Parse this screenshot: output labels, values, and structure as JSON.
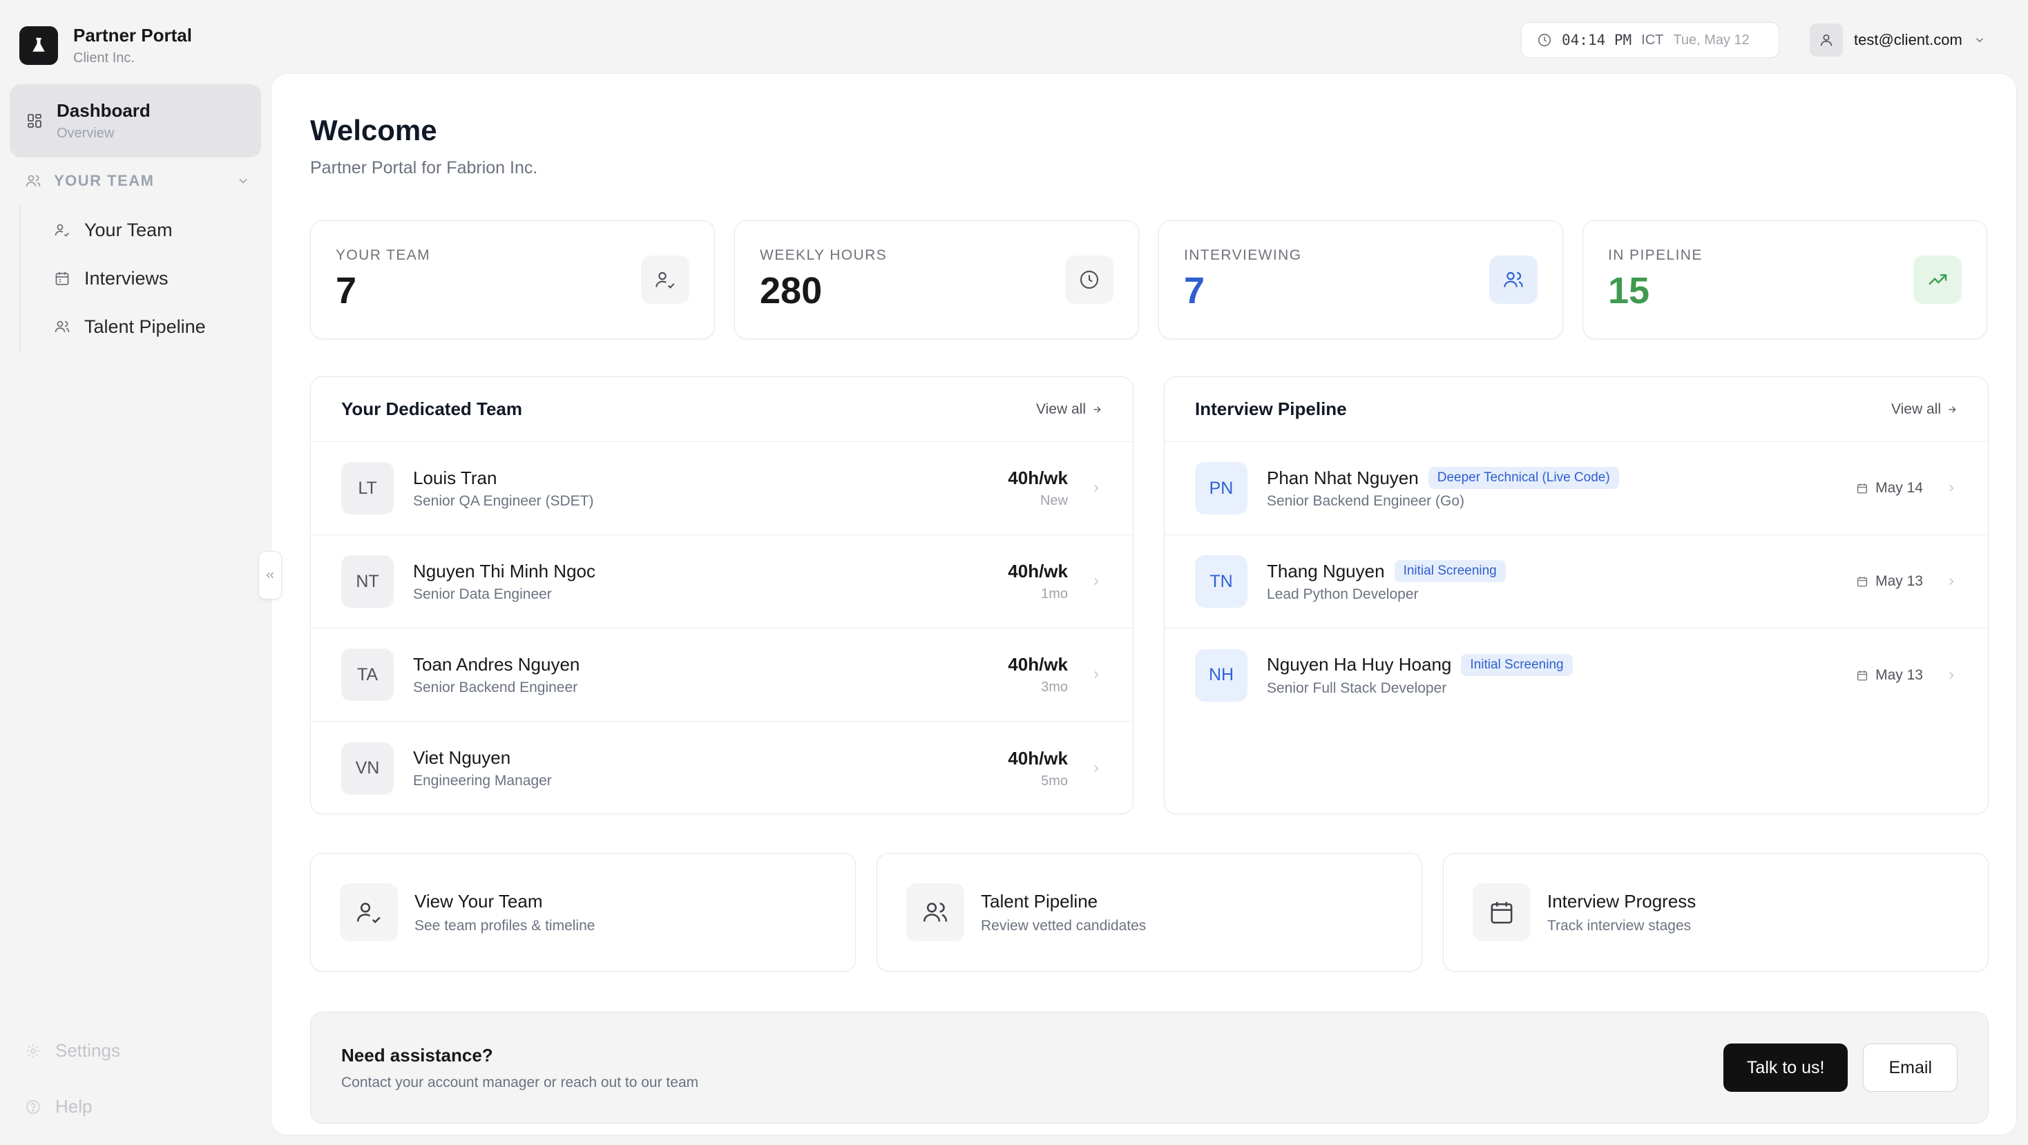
{
  "brand": {
    "title": "Partner Portal",
    "subtitle": "Client Inc."
  },
  "sidebar": {
    "dashboard": {
      "label": "Dashboard",
      "sub": "Overview"
    },
    "section": {
      "label": "YOUR TEAM"
    },
    "items": [
      {
        "label": "Your Team",
        "icon": "user-check-icon"
      },
      {
        "label": "Interviews",
        "icon": "calendar-icon"
      },
      {
        "label": "Talent Pipeline",
        "icon": "users-icon"
      }
    ],
    "settings": "Settings",
    "help": "Help"
  },
  "topbar": {
    "time": "04:14 PM",
    "timezone": "ICT",
    "date": "Tue, May 12",
    "email": "test@client.com"
  },
  "main": {
    "title": "Welcome",
    "subtitle": "Partner Portal for Fabrion Inc."
  },
  "stats": [
    {
      "label": "YOUR TEAM",
      "value": "7",
      "color": "#18181b",
      "icon": "user-check-icon"
    },
    {
      "label": "WEEKLY HOURS",
      "value": "280",
      "color": "#18181b",
      "icon": "clock-icon"
    },
    {
      "label": "INTERVIEWING",
      "value": "7",
      "color": "#2f5fce",
      "icon": "users-icon"
    },
    {
      "label": "IN PIPELINE",
      "value": "15",
      "color": "#3d9a4e",
      "icon": "trending-up-icon"
    }
  ],
  "team": {
    "title": "Your Dedicated Team",
    "view_all": "View all",
    "members": [
      {
        "initials": "LT",
        "name": "Louis Tran",
        "role": "Senior QA Engineer (SDET)",
        "hours": "40h/wk",
        "tenure": "New"
      },
      {
        "initials": "NT",
        "name": "Nguyen Thi Minh Ngoc",
        "role": "Senior Data Engineer",
        "hours": "40h/wk",
        "tenure": "1mo"
      },
      {
        "initials": "TA",
        "name": "Toan Andres Nguyen",
        "role": "Senior Backend Engineer",
        "hours": "40h/wk",
        "tenure": "3mo"
      },
      {
        "initials": "VN",
        "name": "Viet Nguyen",
        "role": "Engineering Manager",
        "hours": "40h/wk",
        "tenure": "5mo"
      }
    ]
  },
  "pipeline": {
    "title": "Interview Pipeline",
    "view_all": "View all",
    "candidates": [
      {
        "initials": "PN",
        "name": "Phan Nhat Nguyen",
        "stage": "Deeper Technical (Live Code)",
        "role": "Senior Backend Engineer (Go)",
        "date": "May 14"
      },
      {
        "initials": "TN",
        "name": "Thang Nguyen",
        "stage": "Initial Screening",
        "role": "Lead Python Developer",
        "date": "May 13"
      },
      {
        "initials": "NH",
        "name": "Nguyen Ha Huy Hoang",
        "stage": "Initial Screening",
        "role": "Senior Full Stack Developer",
        "date": "May 13"
      }
    ]
  },
  "quick_actions": [
    {
      "title": "View Your Team",
      "sub": "See team profiles & timeline",
      "icon": "user-check-icon"
    },
    {
      "title": "Talent Pipeline",
      "sub": "Review vetted candidates",
      "icon": "users-icon"
    },
    {
      "title": "Interview Progress",
      "sub": "Track interview stages",
      "icon": "calendar-icon"
    }
  ],
  "assist": {
    "title": "Need assistance?",
    "sub": "Contact your account manager or reach out to our team",
    "talk": "Talk to us!",
    "email": "Email"
  }
}
